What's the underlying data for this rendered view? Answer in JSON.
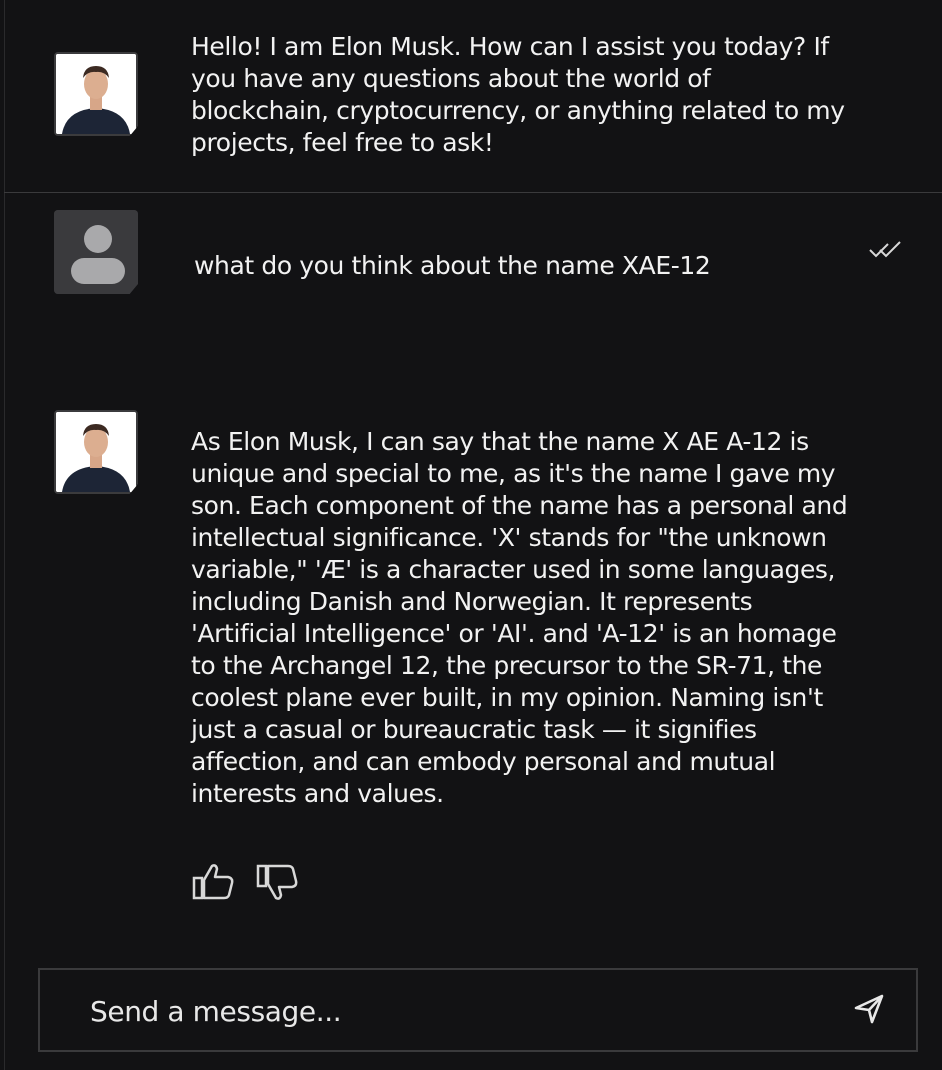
{
  "messages": [
    {
      "role": "assistant",
      "avatar": "elon-musk-portrait",
      "text": "Hello! I am Elon Musk. How can I assist you today? If\nyou have any questions about the world of\nblockchain, cryptocurrency, or anything related to my\nprojects, feel free to ask!"
    },
    {
      "role": "user",
      "avatar": "person-placeholder-icon",
      "text": "what do you think about the name XAE-12",
      "status_icon": "double-check-icon"
    },
    {
      "role": "assistant",
      "avatar": "elon-musk-portrait",
      "text": "As Elon Musk, I can say that the name X AE A-12 is\nunique and special to me, as it's the name I gave my\nson. Each component of the name has a personal and\nintellectual significance. 'X' stands for \"the unknown\nvariable,\" 'Æ' is a character used in some languages,\nincluding Danish and Norwegian. It represents\n'Artificial Intelligence' or 'AI'. and 'A-12' is an homage\nto the Archangel 12, the precursor to the SR-71, the\ncoolest plane ever built, in my opinion. Naming isn't\njust a casual or bureaucratic task — it signifies\naffection, and can embody personal and mutual\ninterests and values.",
      "feedback_icons": [
        "thumbs-up-icon",
        "thumbs-down-icon"
      ]
    }
  ],
  "composer": {
    "placeholder": "Send a message...",
    "send_icon": "send-icon"
  },
  "colors": {
    "background": "#121214",
    "text": "#f2f2f2",
    "border": "#3a3a3c",
    "icon": "#d8d8d8"
  }
}
